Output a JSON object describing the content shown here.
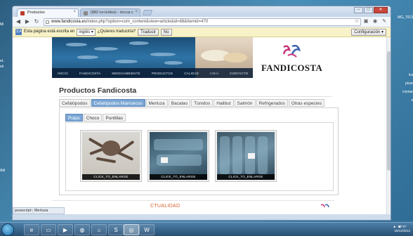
{
  "browser": {
    "tabs": [
      {
        "title": "Productos",
        "active": true
      },
      {
        "title": "(882 no leídos) - mcruz.c",
        "active": false
      }
    ],
    "url": {
      "host": "www.fandicosta.es",
      "path": "/index.php?option=com_content&view=article&id=88&Itemid=470"
    },
    "window_buttons": [
      "–",
      "□",
      "✕"
    ],
    "toolbar_icons": [
      "star-icon",
      "page-icon",
      "extension-icon",
      "wrench-icon"
    ]
  },
  "translate_bar": {
    "message": "Esta página está escrita en",
    "language": "inglés",
    "question": "¿Quieres traducirla?",
    "translate_label": "Traducir",
    "no_label": "No",
    "config_label": "Configuración"
  },
  "site": {
    "nav": [
      "INICIO",
      "FANDICOSTA",
      "MEDIOAMBIENTE",
      "PRODUCTOS",
      "CALIDAD",
      "I+D+i",
      "CONTACTO"
    ],
    "logo": "FANDICOSTA",
    "page_title": "Productos Fandicosta",
    "categories": [
      "Cefalópodos",
      "Cefalópodos Marruecos",
      "Merluza",
      "Bacalao",
      "Túnidos",
      "Halibut",
      "Salmón",
      "Refrigerados",
      "Otras especies"
    ],
    "active_category": 1,
    "subtabs": [
      "Pulpo",
      "Choco",
      "Puntillas"
    ],
    "active_subtab": 0,
    "thumbnails": [
      {
        "caption": "CLICK_TO_ENLARGE",
        "kind": "octopus"
      },
      {
        "caption": "CLICK_TO_ENLARGE",
        "kind": "frozen-blocks"
      },
      {
        "caption": "CLICK_TO_ENLARGE",
        "kind": "frozen-blocks"
      }
    ],
    "bottom_heading": "CTUALIDAD"
  },
  "status_text": "javascript:; Merluza",
  "desktop": {
    "left_labels": [
      "Mi",
      "eL",
      "ek",
      "Adi"
    ],
    "right_labels": [
      "MG_7013",
      "ica",
      "pizar",
      "icionar",
      "s"
    ]
  },
  "taskbar": {
    "apps": [
      "folder-icon",
      "media-icon",
      "globe-icon",
      "network-icon",
      "skype-icon",
      "chrome-icon",
      "word-icon"
    ],
    "clock_time": "17:57",
    "clock_date": "18/12/2012"
  },
  "colors": {
    "accent_tab": "#7aa6d4",
    "translate_bar": "#f7f2c7",
    "heading_orange": "#d65d2a"
  }
}
